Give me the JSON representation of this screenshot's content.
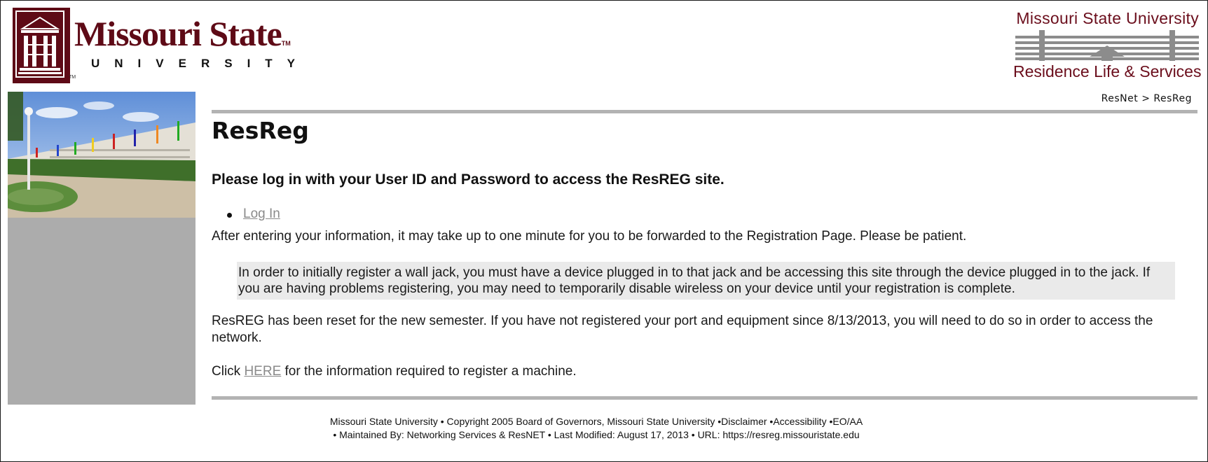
{
  "header": {
    "msu_logo": {
      "name": "Missouri State",
      "trademark": "TM",
      "subtitle": "UNIVERSITY"
    },
    "reslife_logo": {
      "top": "Missouri State University",
      "bottom": "Residence Life & Services"
    }
  },
  "breadcrumb": "ResNet > ResReg",
  "page_title": "ResReg",
  "lead": "Please log in with your User ID and Password to access the ResREG site.",
  "login_link": "Log In",
  "p1": "After entering your information, it may take up to one minute for you to be forwarded to the Registration Page. Please be patient.",
  "note": "In order to initially register a wall jack, you must have a device plugged in to that jack and be accessing this site through the device plugged in to the jack. If you are having problems registering, you may need to temporarily disable wireless on your device until your registration is complete.",
  "p2": "ResREG has been reset for the new semester. If you have not registered your port and equipment since 8/13/2013, you will need to do so in order to access the network.",
  "p3": {
    "before": "Click",
    "link": "HERE",
    "after": "for the information required to register a machine."
  },
  "footer": {
    "line1": {
      "org": "Missouri State University",
      "copyright": "• Copyright 2005 Board of Governors, Missouri State University",
      "disclaimer": "•Disclaimer",
      "accessibility": "•Accessibility",
      "eoaa": "•EO/AA"
    },
    "line2": "• Maintained By: Networking Services & ResNET  • Last Modified: August 17, 2013 • URL: https://resreg.missouristate.edu"
  },
  "colors": {
    "maroon": "#5e0a16",
    "sidebar_gray": "#acacac",
    "rule_gray": "#b3b3b3",
    "note_bg": "#eaeaea",
    "link": "#8a8a8a"
  },
  "icons": {
    "seal": "university-building-seal-icon",
    "reslife_mark": "residence-hall-bars-icon",
    "bullet": "bullet-icon"
  }
}
